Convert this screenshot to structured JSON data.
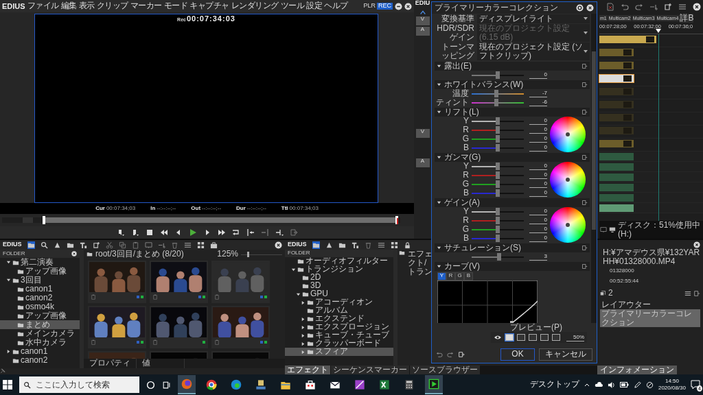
{
  "player": {
    "brand": "EDIUS",
    "menu": [
      "ファイル",
      "編集",
      "表示",
      "クリップ",
      "マーカー",
      "モード",
      "キャプチャ",
      "レンダリング",
      "ツール",
      "設定",
      "ヘルプ"
    ],
    "modes": [
      {
        "label": "PLR",
        "selected": false
      },
      {
        "label": "REC",
        "selected": true
      }
    ],
    "timecode_label": "Rec",
    "timecode": "00:07:34:03",
    "readouts": [
      {
        "label": "Cur",
        "value": "00:07:34;03"
      },
      {
        "label": "In",
        "value": "--:--:--;--"
      },
      {
        "label": "Out",
        "value": "--:--:--;--"
      },
      {
        "label": "Dur",
        "value": "--:--:--;--"
      },
      {
        "label": "Ttl",
        "value": "00:07:34;03"
      }
    ]
  },
  "timeline": {
    "title": "EDIU",
    "track_headers": [
      {
        "label": "V"
      },
      {
        "label": "A"
      },
      {
        "label": "V"
      },
      {
        "label": "A"
      }
    ],
    "tabs": [
      {
        "label": "m1",
        "selected": false
      },
      {
        "label": "Multicam2",
        "selected": false
      },
      {
        "label": "Multicam3",
        "selected": false
      },
      {
        "label": "Multicam4",
        "selected": false
      },
      {
        "label": "詳B",
        "selected": false
      }
    ],
    "ruler": [
      "00:07:28;00",
      "00:07:32;00",
      "00:07:36;0"
    ],
    "tracks": [
      {
        "kind": "video",
        "color": "#c9a94f",
        "selected": false
      },
      {
        "kind": "video",
        "color": "#6c5d2a",
        "selected": false
      },
      {
        "kind": "video",
        "color": "#6c5d2a",
        "selected": false
      },
      {
        "kind": "video",
        "color": "#dcdcdc",
        "selected": true
      },
      {
        "kind": "video",
        "color": "#35301f",
        "selected": false
      },
      {
        "kind": "video",
        "color": "#35301f",
        "selected": false
      },
      {
        "kind": "video",
        "color": "#35301f",
        "selected": false
      },
      {
        "kind": "video",
        "color": "#35301f",
        "selected": false
      },
      {
        "kind": "video",
        "color": "#6c5d2a",
        "selected": false
      },
      {
        "kind": "audio",
        "color": "#2e5a40",
        "selected": false
      },
      {
        "kind": "audio",
        "color": "#2e5a40",
        "selected": false
      },
      {
        "kind": "audio",
        "color": "#2e5a40",
        "selected": false
      },
      {
        "kind": "audio",
        "color": "#2e5a40",
        "selected": false
      },
      {
        "kind": "audio",
        "color": "#2e5a40",
        "selected": false
      },
      {
        "kind": "audio",
        "color": "#5f9a74",
        "selected": false
      }
    ],
    "status": "ディスク：51%使用中(H:)"
  },
  "dialog": {
    "title": "プライマリーカラーコレクション",
    "settings": [
      {
        "label": "変換基準",
        "value": "ディスプレイライト",
        "disabled": false
      },
      {
        "label": "HDR/SDRゲイン",
        "value": "現在のプロジェクト設定 (6.15 dB)",
        "disabled": true
      },
      {
        "label": "トーンマッピング",
        "value": "現在のプロジェクト設定 (ソフトクリップ)",
        "disabled": false
      }
    ],
    "sections": [
      {
        "title": "露出(E)",
        "kind": "sliders",
        "sliders": [
          {
            "kind": "plain",
            "level": 0.5,
            "reading": "0"
          }
        ]
      },
      {
        "title": "ホワイトバランス(W)",
        "kind": "sliders",
        "sliders": [
          {
            "label": "温度",
            "kind": "temperature",
            "level": 0.47,
            "reading": "-7"
          },
          {
            "label": "ティント",
            "kind": "tint",
            "level": 0.47,
            "reading": "-6"
          }
        ]
      },
      {
        "title": "リフト(L)",
        "kind": "wheel",
        "sliders": [
          {
            "label": "Y",
            "kind": "channel",
            "color": "#b4b4b4",
            "level": 0.5,
            "reading": "0"
          },
          {
            "label": "R",
            "kind": "channel",
            "color": "#b02020",
            "level": 0.5,
            "reading": "0"
          },
          {
            "label": "G",
            "kind": "channel",
            "color": "#20a020",
            "level": 0.5,
            "reading": "0"
          },
          {
            "label": "B",
            "kind": "channel",
            "color": "#2828d0",
            "level": 0.5,
            "reading": "0"
          }
        ]
      },
      {
        "title": "ガンマ(G)",
        "kind": "wheel",
        "sliders": [
          {
            "label": "Y",
            "kind": "channel",
            "color": "#b4b4b4",
            "level": 0.5,
            "reading": "0"
          },
          {
            "label": "R",
            "kind": "channel",
            "color": "#b02020",
            "level": 0.5,
            "reading": "0"
          },
          {
            "label": "G",
            "kind": "channel",
            "color": "#20a020",
            "level": 0.5,
            "reading": "0"
          },
          {
            "label": "B",
            "kind": "channel",
            "color": "#2828d0",
            "level": 0.5,
            "reading": "0"
          }
        ]
      },
      {
        "title": "ゲイン(A)",
        "kind": "wheel",
        "sliders": [
          {
            "label": "Y",
            "kind": "channel",
            "color": "#b4b4b4",
            "level": 0.5,
            "reading": "0"
          },
          {
            "label": "R",
            "kind": "channel",
            "color": "#b02020",
            "level": 0.5,
            "reading": "0"
          },
          {
            "label": "G",
            "kind": "channel",
            "color": "#20a020",
            "level": 0.5,
            "reading": "0"
          },
          {
            "label": "B",
            "kind": "channel",
            "color": "#2828d0",
            "level": 0.5,
            "reading": "0"
          }
        ]
      },
      {
        "title": "サチュレーション(S)",
        "kind": "sliders",
        "sliders": [
          {
            "kind": "plain",
            "level": 0.52,
            "reading": "3"
          }
        ]
      },
      {
        "title": "カーブ(V)",
        "kind": "curve",
        "channels": [
          {
            "label": "Y",
            "selected": true
          },
          {
            "label": "R",
            "selected": false
          },
          {
            "label": "G",
            "selected": false
          },
          {
            "label": "B",
            "selected": false
          }
        ]
      }
    ],
    "preview": {
      "label": "プレビュー(P)",
      "modes": [
        {
          "selected": true
        },
        {
          "selected": false
        },
        {
          "selected": false
        },
        {
          "selected": false
        },
        {
          "selected": false
        }
      ],
      "reading": "50%"
    },
    "buttons": [
      "OK",
      "キャンセル"
    ]
  },
  "bin": {
    "brand": "EDIUS",
    "folder_header": "FOLDER",
    "tree": [
      {
        "label": "第二演奏",
        "expanded": true,
        "selected": false,
        "children": [
          {
            "label": "アップ画像",
            "selected": false
          }
        ]
      },
      {
        "label": "3回目",
        "expanded": true,
        "selected": false,
        "children": [
          {
            "label": "canon1",
            "selected": false
          },
          {
            "label": "canon2",
            "selected": false
          },
          {
            "label": "osmo4k",
            "selected": false
          },
          {
            "label": "アップ画像",
            "selected": false
          },
          {
            "label": "まとめ",
            "selected": true
          },
          {
            "label": "メインカメラ",
            "selected": false
          },
          {
            "label": "水中カメラ",
            "selected": false
          }
        ]
      },
      {
        "label": "canon1",
        "expanded": false,
        "selected": false
      },
      {
        "label": "canon2",
        "selected": false
      }
    ],
    "path": "root/3回目/まとめ (8/20)",
    "zoom": "125%",
    "zoom_slider": {
      "level": 0.15
    },
    "thumbnails": [
      {
        "kind": "picture",
        "dots": [
          {
            "color": "#3060c0"
          },
          {
            "color": "#20b040"
          }
        ]
      },
      {
        "kind": "picture",
        "dots": [
          {
            "color": "#3060c0"
          },
          {
            "color": "#20b040"
          }
        ]
      },
      {
        "kind": "picture",
        "dots": [
          {
            "color": "#3060c0"
          },
          {
            "color": "#20b040"
          }
        ]
      },
      {
        "kind": "picture",
        "dots": [
          {
            "color": "#3060c0"
          },
          {
            "color": "#20b040"
          }
        ]
      },
      {
        "kind": "picture",
        "dots": [
          {
            "color": "#20b040"
          }
        ]
      },
      {
        "kind": "picture",
        "dots": [
          {
            "color": "#3060c0"
          },
          {
            "color": "#20b040"
          }
        ]
      },
      {
        "kind": "picture"
      },
      {
        "kind": "picture"
      },
      {
        "kind": "picture"
      }
    ],
    "properties": [
      "プロパティ",
      "値"
    ]
  },
  "effects": {
    "brand": "EDIUS",
    "folder_header": "FOLDER",
    "tree": [
      {
        "label": "オーディオフィルター",
        "selected": false
      },
      {
        "label": "トランジション",
        "expanded": true,
        "selected": false,
        "children": [
          {
            "label": "2D",
            "selected": false
          },
          {
            "label": "3D",
            "selected": false
          },
          {
            "label": "GPU",
            "expanded": true,
            "selected": false,
            "children": [
              {
                "label": "アコーディオン",
                "expanded": false,
                "selected": false
              },
              {
                "label": "アルバム",
                "selected": false
              },
              {
                "label": "エクステンド",
                "expanded": false,
                "selected": false
              },
              {
                "label": "エクスプロージョン",
                "expanded": false,
                "selected": false
              },
              {
                "label": "キューブ・チューブ",
                "expanded": false,
                "selected": false
              },
              {
                "label": "クラッパーボード",
                "expanded": false,
                "selected": false
              },
              {
                "label": "スフィア",
                "expanded": false,
                "selected": true
              }
            ]
          }
        ]
      }
    ],
    "path": "エフェクト/トラン",
    "tabs": [
      {
        "label": "エフェクト",
        "selected": true
      },
      {
        "label": "シーケンスマーカー",
        "selected": false
      },
      {
        "label": "ソースブラウザー",
        "selected": false
      }
    ]
  },
  "info": {
    "file": "H:¥アマデウス県¥132YARHH¥01328000.MP4",
    "rows": [
      "01328000",
      "00:52:55:44"
    ],
    "layer_count": "2",
    "filters": [
      {
        "label": "レイアウター",
        "selected": false
      },
      {
        "label": "プライマリーカラーコレクション",
        "selected": true
      }
    ],
    "tab": "インフォメーション"
  },
  "taskbar": {
    "search_placeholder": "ここに入力して検索",
    "apps": [
      {
        "kind": "fox",
        "active": true
      },
      {
        "kind": "chrome",
        "active": false
      },
      {
        "kind": "edge",
        "active": false
      },
      {
        "kind": "device",
        "active": false
      },
      {
        "kind": "folder",
        "active": false
      },
      {
        "kind": "store",
        "active": false
      },
      {
        "kind": "mail",
        "active": false
      },
      {
        "kind": "prism",
        "active": false
      },
      {
        "kind": "sheet",
        "active": false
      },
      {
        "kind": "calc",
        "active": false
      },
      {
        "kind": "player",
        "active": true
      }
    ],
    "desktop": "デスクトップ",
    "time": "14:50",
    "date": "2020/08/30",
    "notifications": "4"
  }
}
